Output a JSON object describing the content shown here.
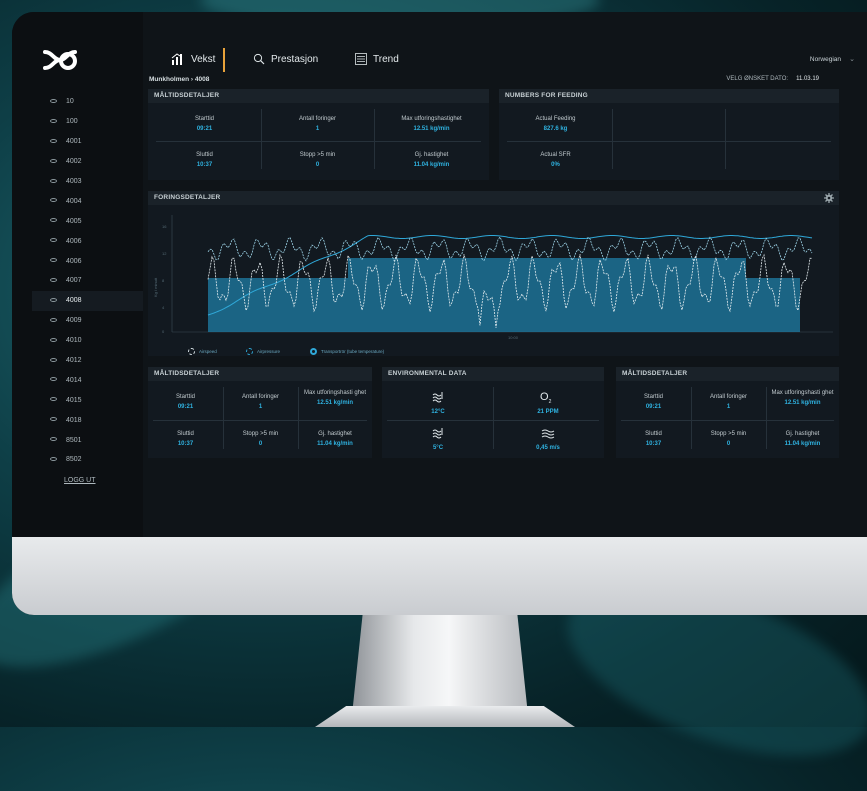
{
  "tabs": [
    {
      "label": "Vekst",
      "icon": "bar-chart-icon"
    },
    {
      "label": "Prestasjon",
      "icon": "search-icon"
    },
    {
      "label": "Trend",
      "icon": "list-icon"
    }
  ],
  "language": "Norwegian",
  "breadcrumb": "Munkholmen › 4008",
  "date": {
    "label": "VELG ØNSKET DATO:",
    "value": "11.03.19"
  },
  "sidebar": {
    "items": [
      "10",
      "100",
      "4001",
      "4002",
      "4003",
      "4004",
      "4005",
      "4006",
      "4006",
      "4007",
      "4008",
      "4009",
      "4010",
      "4012",
      "4014",
      "4015",
      "4018",
      "8501",
      "8502"
    ],
    "active_index": 10,
    "logout": "LOGG UT"
  },
  "meal_details": {
    "title": "MÅLTIDSDETALJER",
    "start_label": "Starttid",
    "start_value": "09:21",
    "feedings_label": "Antall foringer",
    "feedings_value": "1",
    "maxrate_label": "Max utforingshastighet",
    "maxrate_value": "12.51 kg/min",
    "end_label": "Sluttid",
    "end_value": "10:37",
    "stop_label": "Stopp >5 min",
    "stop_value": "0",
    "avg_label": "Gj. hastighet",
    "avg_value": "11.04 kg/min"
  },
  "meal_details_small": {
    "maxrate_label": "Max utforingshasti ghet"
  },
  "feeding_numbers": {
    "title": "NUMBERS FOR FEEDING",
    "actual_label": "Actual Feeding",
    "actual_value": "827.6 kg",
    "sfr_label": "Actual SFR",
    "sfr_value": "0%"
  },
  "feeding_details": {
    "title": "FORINGSDETALJER",
    "y_ticks": [
      "16",
      "12",
      "8",
      "4",
      "0"
    ],
    "y_label": "Kg / minutt",
    "x_tick": "10:00",
    "legend": [
      "Airspeed",
      "Airpressure",
      "Transportrör (tube temperature)"
    ]
  },
  "environmental": {
    "title": "ENVIRONMENTAL DATA",
    "temp_top": "12°C",
    "oxygen": "21 PPM",
    "oxygen_symbol": "O",
    "temp_bottom": "5°C",
    "current": "0,45 m/s"
  },
  "colors": {
    "accent": "#2fb2e0",
    "tab_marker": "#e8a23a",
    "panel": "#121920"
  }
}
